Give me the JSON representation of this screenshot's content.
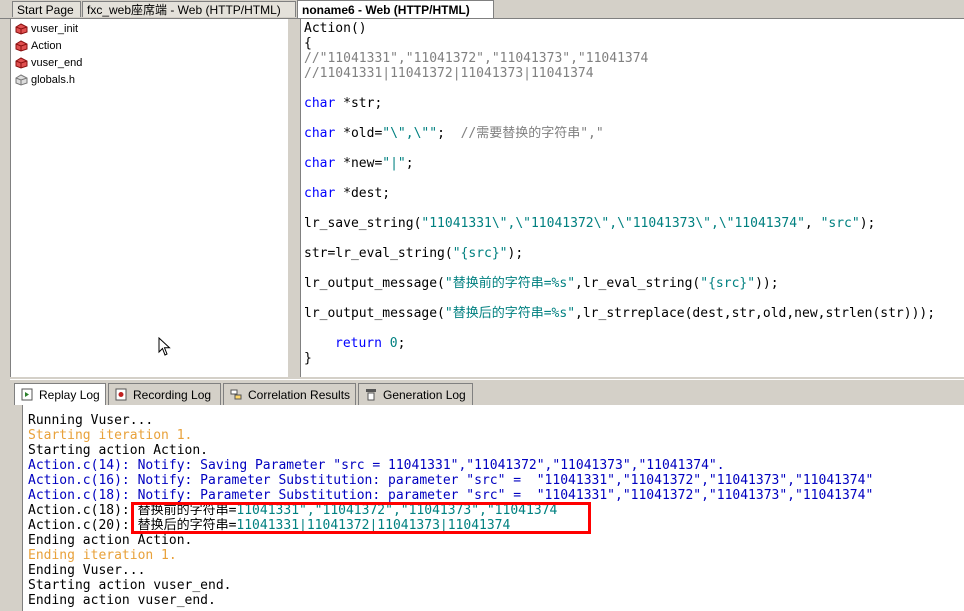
{
  "tabs": [
    {
      "label": "Start Page"
    },
    {
      "label": "fxc_web座席端 - Web (HTTP/HTML)"
    },
    {
      "label": "noname6 - Web (HTTP/HTML)"
    }
  ],
  "tree": {
    "items": [
      {
        "label": "vuser_init"
      },
      {
        "label": "Action"
      },
      {
        "label": "vuser_end"
      },
      {
        "label": "globals.h"
      }
    ]
  },
  "editor": {
    "line_action": "Action()",
    "brace_open": "{",
    "comment1": "//\"11041331\",\"11041372\",\"11041373\",\"11041374",
    "comment2": "//11041331|11041372|11041373|11041374",
    "kw_char": "char",
    "decl_str": " *str;",
    "decl_old_a": " *old=",
    "decl_old_s": "\"\\\",\\\"\"",
    "decl_old_b": ";  ",
    "decl_old_c": "//需要替换的字符串\",\"",
    "decl_new_a": " *new=",
    "decl_new_s": "\"|\"",
    "decl_new_b": ";",
    "decl_dest": " *dest;",
    "save_a": "lr_save_string(",
    "save_s1": "\"11041331\\\",\\\"11041372\\\",\\\"11041373\\\",\\\"11041374\"",
    "save_b": ", ",
    "save_s2": "\"src\"",
    "save_c": ");",
    "eval_a": "str=lr_eval_string(",
    "eval_s": "\"{src}\"",
    "eval_b": ");",
    "out1_a": "lr_output_message(",
    "out1_s1": "\"替换前的字符串=%s\"",
    "out1_b": ",lr_eval_string(",
    "out1_s2": "\"{src}\"",
    "out1_c": "));",
    "out2_a": "lr_output_message(",
    "out2_s": "\"替换后的字符串=%s\"",
    "out2_b": ",lr_strreplace(dest,str,old,new,strlen(str)));",
    "ret_kw": "return",
    "ret_val": " 0",
    "ret_end": ";",
    "brace_close": "}"
  },
  "bottom_tabs": [
    {
      "label": "Replay Log"
    },
    {
      "label": "Recording Log"
    },
    {
      "label": "Correlation Results"
    },
    {
      "label": "Generation Log"
    }
  ],
  "log": {
    "l1": "Running Vuser...",
    "l2": "Starting iteration 1.",
    "l3": "Starting action Action.",
    "l4": "Action.c(14): Notify: Saving Parameter \"src = 11041331\",\"11041372\",\"11041373\",\"11041374\".",
    "l5": "Action.c(16): Notify: Parameter Substitution: parameter \"src\" =  \"11041331\",\"11041372\",\"11041373\",\"11041374\"",
    "l6": "Action.c(18): Notify: Parameter Substitution: parameter \"src\" =  \"11041331\",\"11041372\",\"11041373\",\"11041374\"",
    "l7_a": "Action.c(18): ",
    "l7_b": "替换前的字符串=",
    "l7_c": "11041331\",\"11041372\",\"11041373\",\"11041374",
    "l8_a": "Action.c(20): ",
    "l8_b": "替换后的字符串=",
    "l8_c": "11041331|11041372|11041373|11041374",
    "l9": "Ending action Action.",
    "l10": "Ending iteration 1.",
    "l11": "Ending Vuser...",
    "l12": "Starting action vuser_end.",
    "l13": "Ending action vuser_end."
  },
  "colors": {
    "keyword": "#0000ff",
    "string": "#008080",
    "comment": "#808080",
    "highlight": "#ff0000"
  }
}
